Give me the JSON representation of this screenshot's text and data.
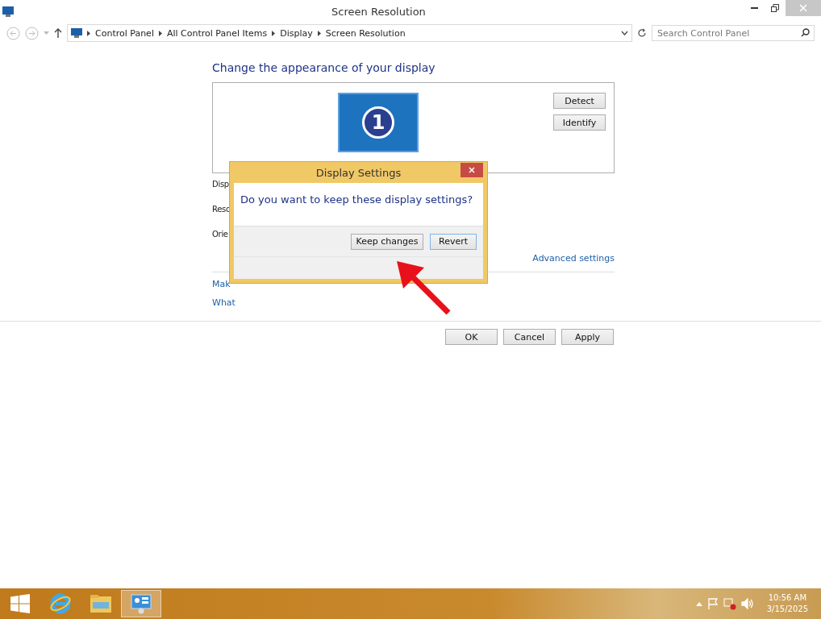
{
  "window": {
    "title": "Screen Resolution"
  },
  "breadcrumb": [
    "Control Panel",
    "All Control Panel Items",
    "Display",
    "Screen Resolution"
  ],
  "search": {
    "placeholder": "Search Control Panel"
  },
  "heading": "Change the appearance of your display",
  "monitor": {
    "number": "1"
  },
  "side_buttons": [
    "Detect",
    "Identify"
  ],
  "settings_labels": [
    "Disp",
    "Reso",
    "Orie"
  ],
  "advanced_link": "Advanced settings",
  "links": [
    "Mak",
    "What"
  ],
  "footer_buttons": [
    "OK",
    "Cancel",
    "Apply"
  ],
  "dialog": {
    "title": "Display Settings",
    "message": "Do you want to keep these display settings?",
    "buttons": [
      {
        "label": "Keep changes",
        "selected": false
      },
      {
        "label": "Revert",
        "selected": true
      }
    ]
  },
  "taskbar": {
    "apps": [
      {
        "kind": "ie",
        "selected": false
      },
      {
        "kind": "explorer",
        "selected": false
      },
      {
        "kind": "control",
        "selected": true
      }
    ],
    "time": "10:56 AM",
    "date": "3/15/2025"
  }
}
